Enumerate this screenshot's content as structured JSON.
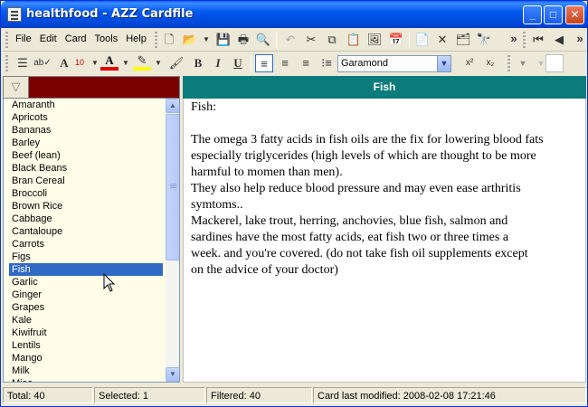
{
  "window": {
    "title": "healthfood - AZZ Cardfile",
    "controls": {
      "minimize": "_",
      "maximize": "□",
      "close": "✕"
    }
  },
  "menu": [
    "File",
    "Edit",
    "Card",
    "Tools",
    "Help"
  ],
  "toolbar1": {
    "icons": [
      "new-icon",
      "open-icon",
      "save-icon",
      "print-icon",
      "print-preview-icon",
      "undo-icon",
      "cut-icon",
      "copy-icon",
      "paste-icon",
      "insert-picture-icon",
      "insert-date-icon",
      "new-card-icon",
      "delete-card-icon",
      "card-properties-icon",
      "find-icon",
      "first-card-icon",
      "previous-card-icon"
    ]
  },
  "toolbar2": {
    "font_size": "10",
    "font_name": "Garamond",
    "bold": "B",
    "italic": "I",
    "underline": "U",
    "superscript": "x²",
    "subscript": "x₂"
  },
  "filter": {
    "color": "#7b0000"
  },
  "list": {
    "items": [
      "Amaranth",
      "Apricots",
      "Bananas",
      "Barley",
      "Beef (lean)",
      "Black Beans",
      "Bran Cereal",
      "Broccoli",
      "Brown Rice",
      "Cabbage",
      "Cantaloupe",
      "Carrots",
      "Figs",
      "Fish",
      "Garlic",
      "Ginger",
      "Grapes",
      "Kale",
      "Kiwifruit",
      "Lentils",
      "Mango",
      "Milk",
      "Miso"
    ],
    "selected_index": 13
  },
  "card": {
    "title": "Fish",
    "header_color": "#0b7b7b",
    "lines": [
      "Fish:",
      "",
      "The omega 3 fatty acids in fish oils are the fix for lowering blood fats",
      "especially triglycerides (high levels of which are thought to be more",
      "harmful to momen than men).",
      "They also help reduce blood pressure and may even ease arthritis",
      "symtoms..",
      "Mackerel, lake trout, herring, anchovies, blue fish, salmon and",
      "sardines have the most fatty acids, eat fish two or three times a",
      "week. and you're covered. (do not take fish oil supplements except",
      "on the advice of your doctor)"
    ]
  },
  "status": {
    "total": "Total: 40",
    "selected": "Selected: 1",
    "filtered": "Filtered: 40",
    "modified": "Card last modified: 2008-02-08  17:21:46"
  }
}
